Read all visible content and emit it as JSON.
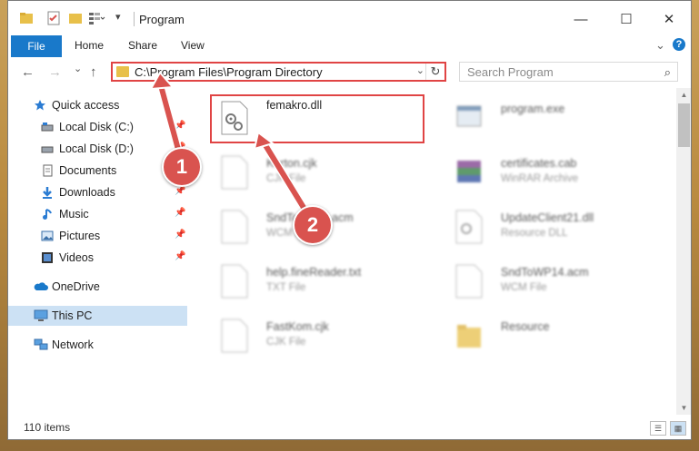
{
  "window": {
    "title": "Program",
    "controls": {
      "minimize": "—",
      "maximize": "☐",
      "close": "✕"
    }
  },
  "ribbon": {
    "file": "File",
    "tabs": [
      "Home",
      "Share",
      "View"
    ],
    "expand": "⌄",
    "help": "?"
  },
  "navigation": {
    "back": "←",
    "forward": "→",
    "recent": "⌄",
    "up": "↑",
    "address": "C:\\Program Files\\Program Directory",
    "address_dropdown": "⌄",
    "refresh": "↻",
    "search_placeholder": "Search Program",
    "search_icon": "⌕"
  },
  "sidebar": {
    "items": [
      {
        "label": "Quick access",
        "icon": "star-icon",
        "pinned": false
      },
      {
        "label": "Local Disk (C:)",
        "icon": "disk-icon",
        "pinned": true
      },
      {
        "label": "Local Disk (D:)",
        "icon": "disk-icon",
        "pinned": true
      },
      {
        "label": "Documents",
        "icon": "documents-icon",
        "pinned": true
      },
      {
        "label": "Downloads",
        "icon": "download-icon",
        "pinned": true
      },
      {
        "label": "Music",
        "icon": "music-icon",
        "pinned": true
      },
      {
        "label": "Pictures",
        "icon": "pictures-icon",
        "pinned": true
      },
      {
        "label": "Videos",
        "icon": "video-icon",
        "pinned": true
      },
      {
        "label": "OneDrive",
        "icon": "cloud-icon",
        "pinned": false
      },
      {
        "label": "This PC",
        "icon": "computer-icon",
        "pinned": false,
        "selected": true
      },
      {
        "label": "Network",
        "icon": "network-icon",
        "pinned": false
      }
    ],
    "pin_glyph": "📌"
  },
  "files": [
    {
      "name": "femakro.dll",
      "type": "",
      "icon": "dll-gear-icon"
    },
    {
      "name": "program.exe",
      "type": "",
      "icon": "exe-icon"
    },
    {
      "name": "Karton.cjk",
      "type": "CJK File",
      "icon": "blank-file-icon"
    },
    {
      "name": "certificates.cab",
      "type": "WinRAR Archive",
      "icon": "winrar-icon"
    },
    {
      "name": "SndToWP11.acm",
      "type": "WCM File",
      "icon": "blank-file-icon"
    },
    {
      "name": "UpdateClient21.dll",
      "type": "Resource DLL",
      "icon": "dll-gear-icon"
    },
    {
      "name": "help.fineReader.txt",
      "type": "TXT File",
      "icon": "blank-file-icon"
    },
    {
      "name": "SndToWP14.acm",
      "type": "WCM File",
      "icon": "blank-file-icon"
    },
    {
      "name": "FastKom.cjk",
      "type": "CJK File",
      "icon": "blank-file-icon"
    },
    {
      "name": "Resource",
      "type": "",
      "icon": "folder-icon"
    }
  ],
  "status": {
    "item_count": "110 items"
  },
  "annotations": {
    "callout_1": "1",
    "callout_2": "2",
    "highlight_color": "#e04444",
    "callout_color": "#d9534f"
  },
  "colors": {
    "accent": "#1979ca",
    "selection": "#cce1f4"
  }
}
